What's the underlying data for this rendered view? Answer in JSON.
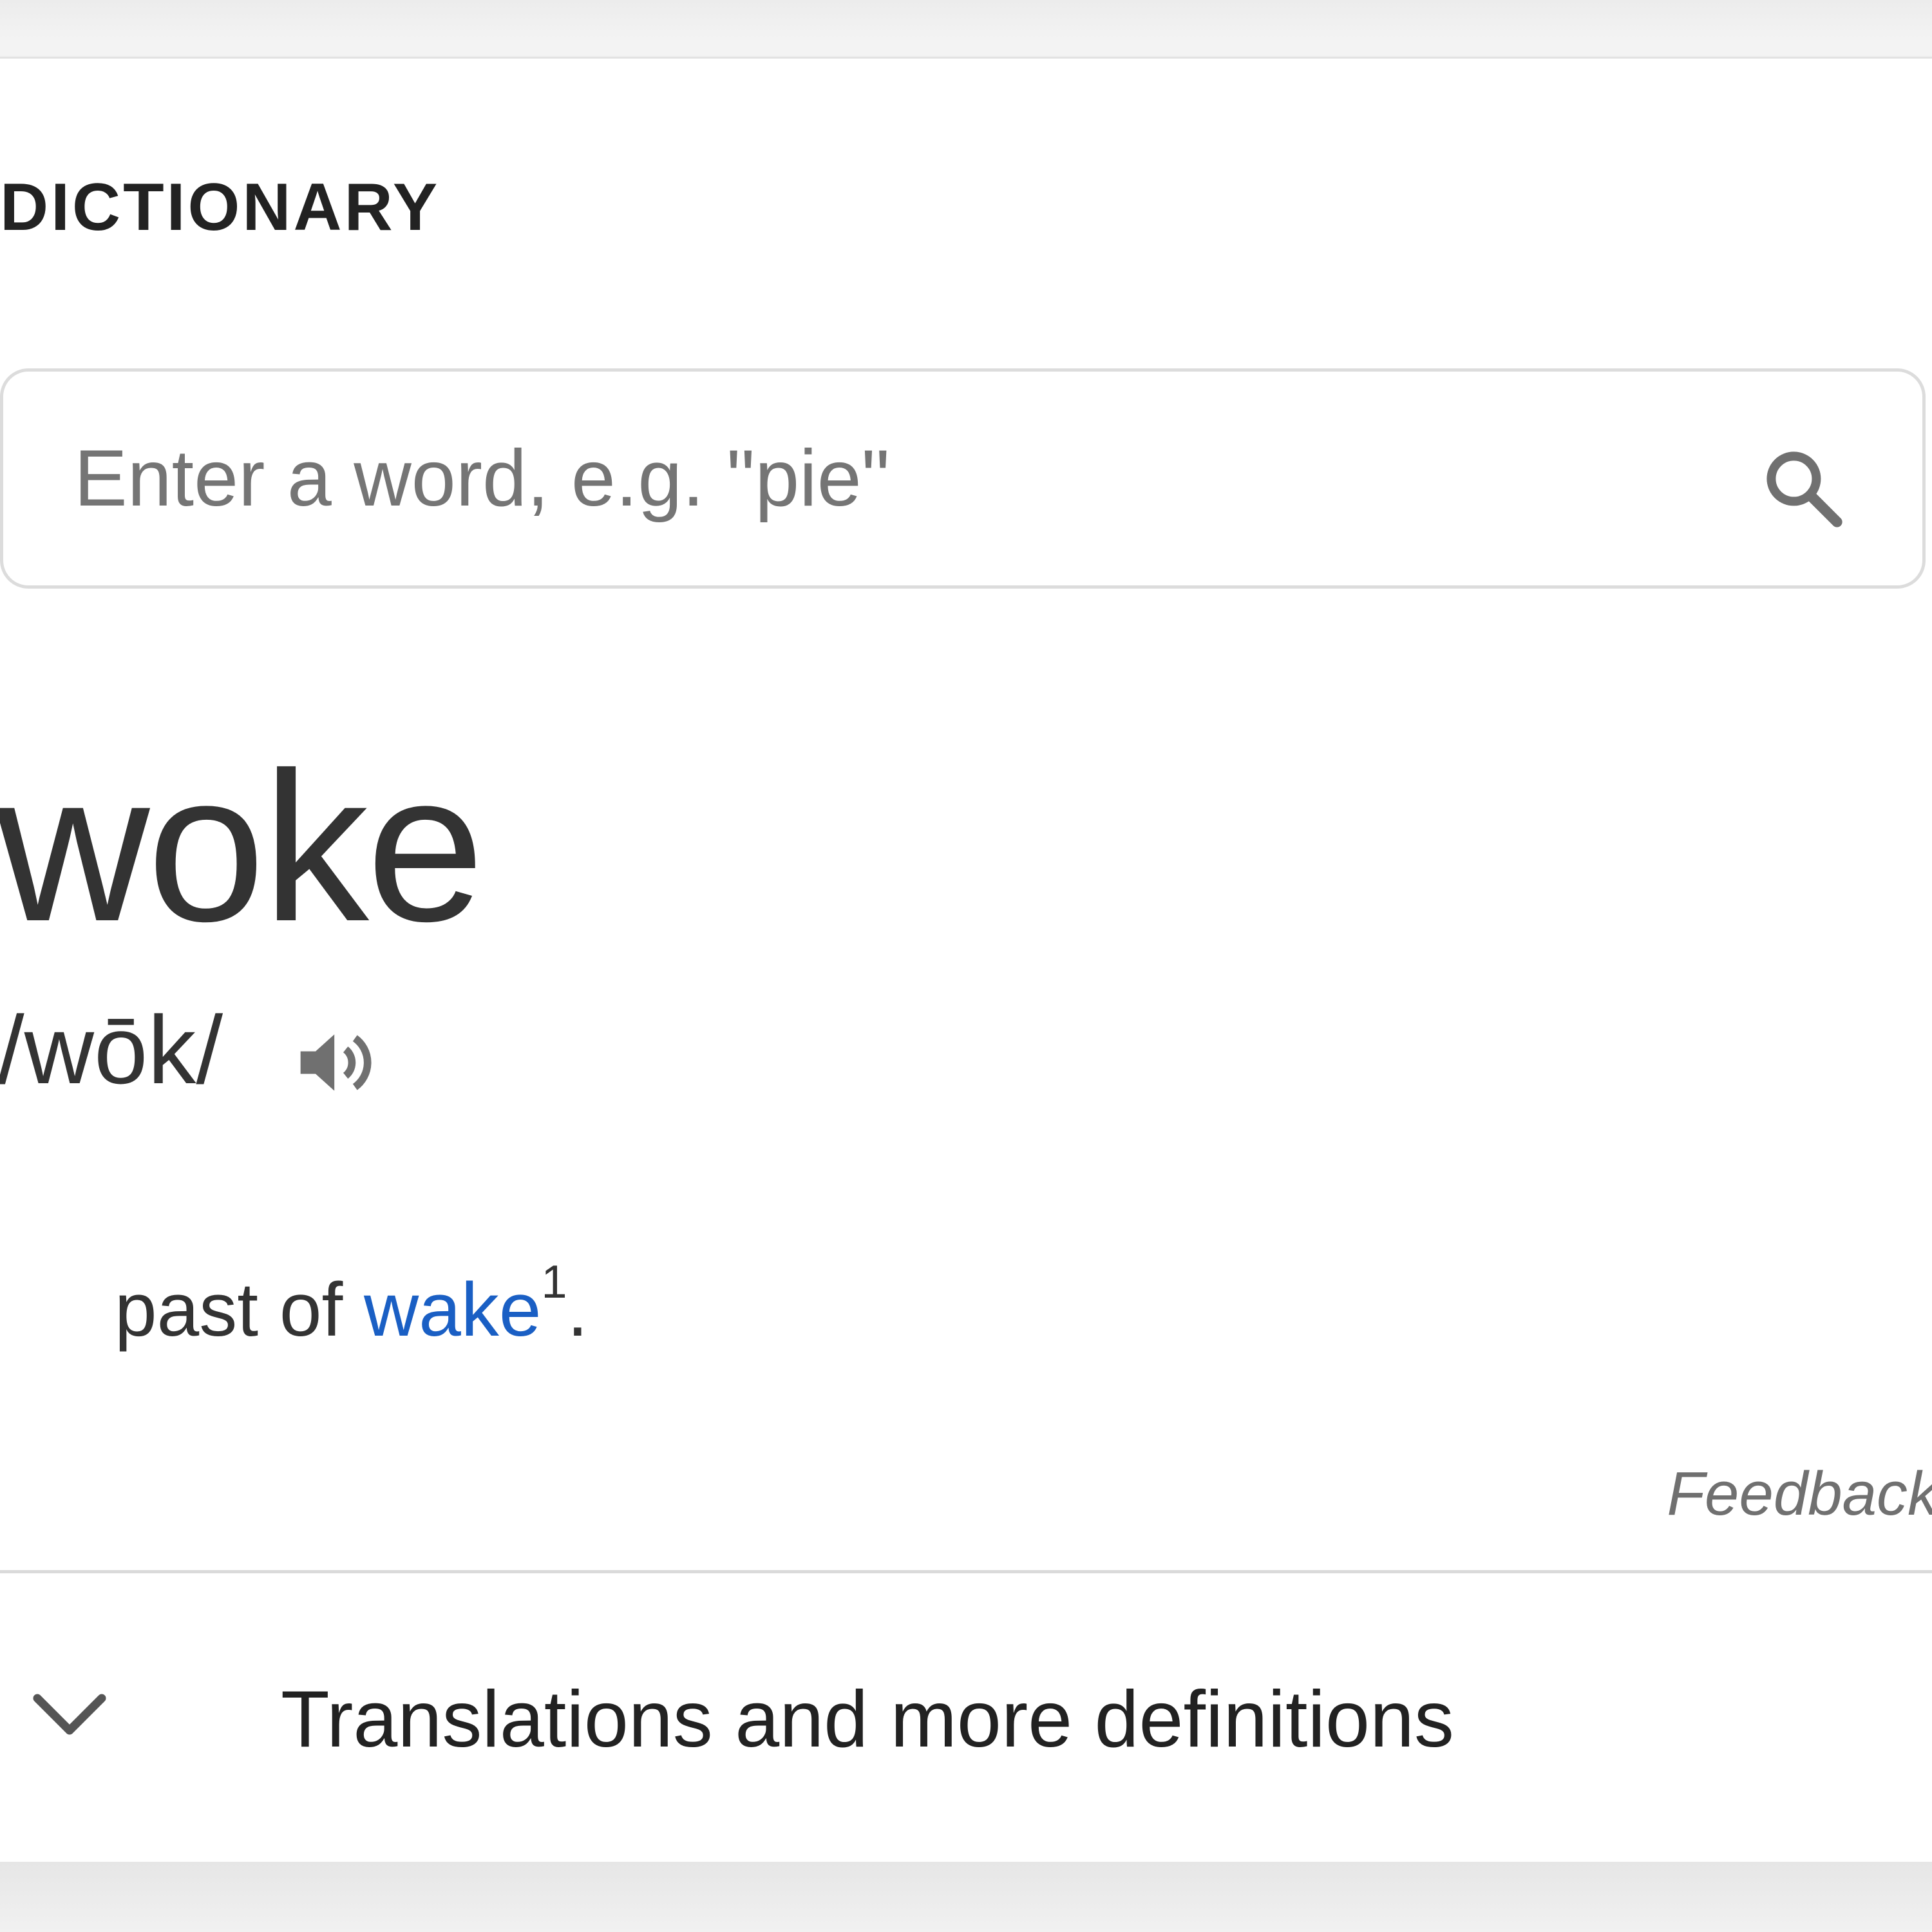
{
  "section": {
    "title": "DICTIONARY"
  },
  "search": {
    "placeholder": "Enter a word, e.g. \"pie\"",
    "value": "",
    "icon": "search-icon"
  },
  "entry": {
    "headword": "woke",
    "phonetic": "/wōk/",
    "audio_icon": "speaker-icon",
    "definition": {
      "prefix": "past of ",
      "link_text": "wake",
      "superscript": "1",
      "suffix": "."
    }
  },
  "footer": {
    "feedback_label": "Feedback",
    "expander_label": "Translations and more definitions",
    "expander_icon": "chevron-down-icon"
  },
  "colors": {
    "link": "#1a5fc4",
    "text": "#333333",
    "muted": "#757575",
    "border": "#dcdcdc"
  }
}
